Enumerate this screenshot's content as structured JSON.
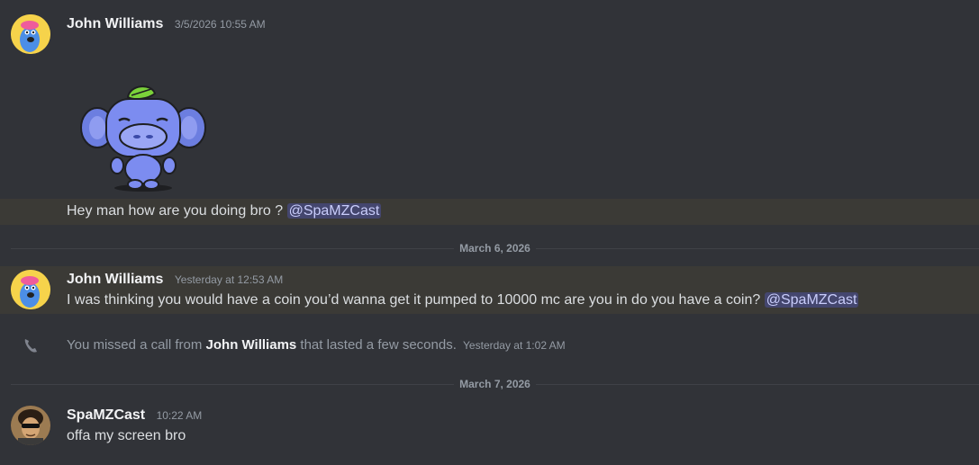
{
  "messages": [
    {
      "author": "John Williams",
      "timestamp": "3/5/2026 10:55 AM",
      "text": "Hey man how are you doing bro ?",
      "mention": "@SpaMZCast"
    },
    {
      "author": "John Williams",
      "timestamp": "Yesterday at 12:53 AM",
      "text": "I was thinking you would have a coin you’d wanna get it pumped to 10000 mc are you in do you have a coin?",
      "mention": "@SpaMZCast"
    },
    {
      "author": "SpaMZCast",
      "timestamp": "10:22 AM",
      "text": "offa my screen bro"
    }
  ],
  "call": {
    "prefix": "You missed a call from",
    "caller": "John Williams",
    "suffix": "that lasted a few seconds.",
    "timestamp": "Yesterday at 1:02 AM"
  },
  "dividers": [
    "March 6, 2026",
    "March 7, 2026"
  ],
  "colors": {
    "background": "#313338",
    "mention_highlight": "#3b3a36",
    "mention_text": "#c9cdfb"
  }
}
